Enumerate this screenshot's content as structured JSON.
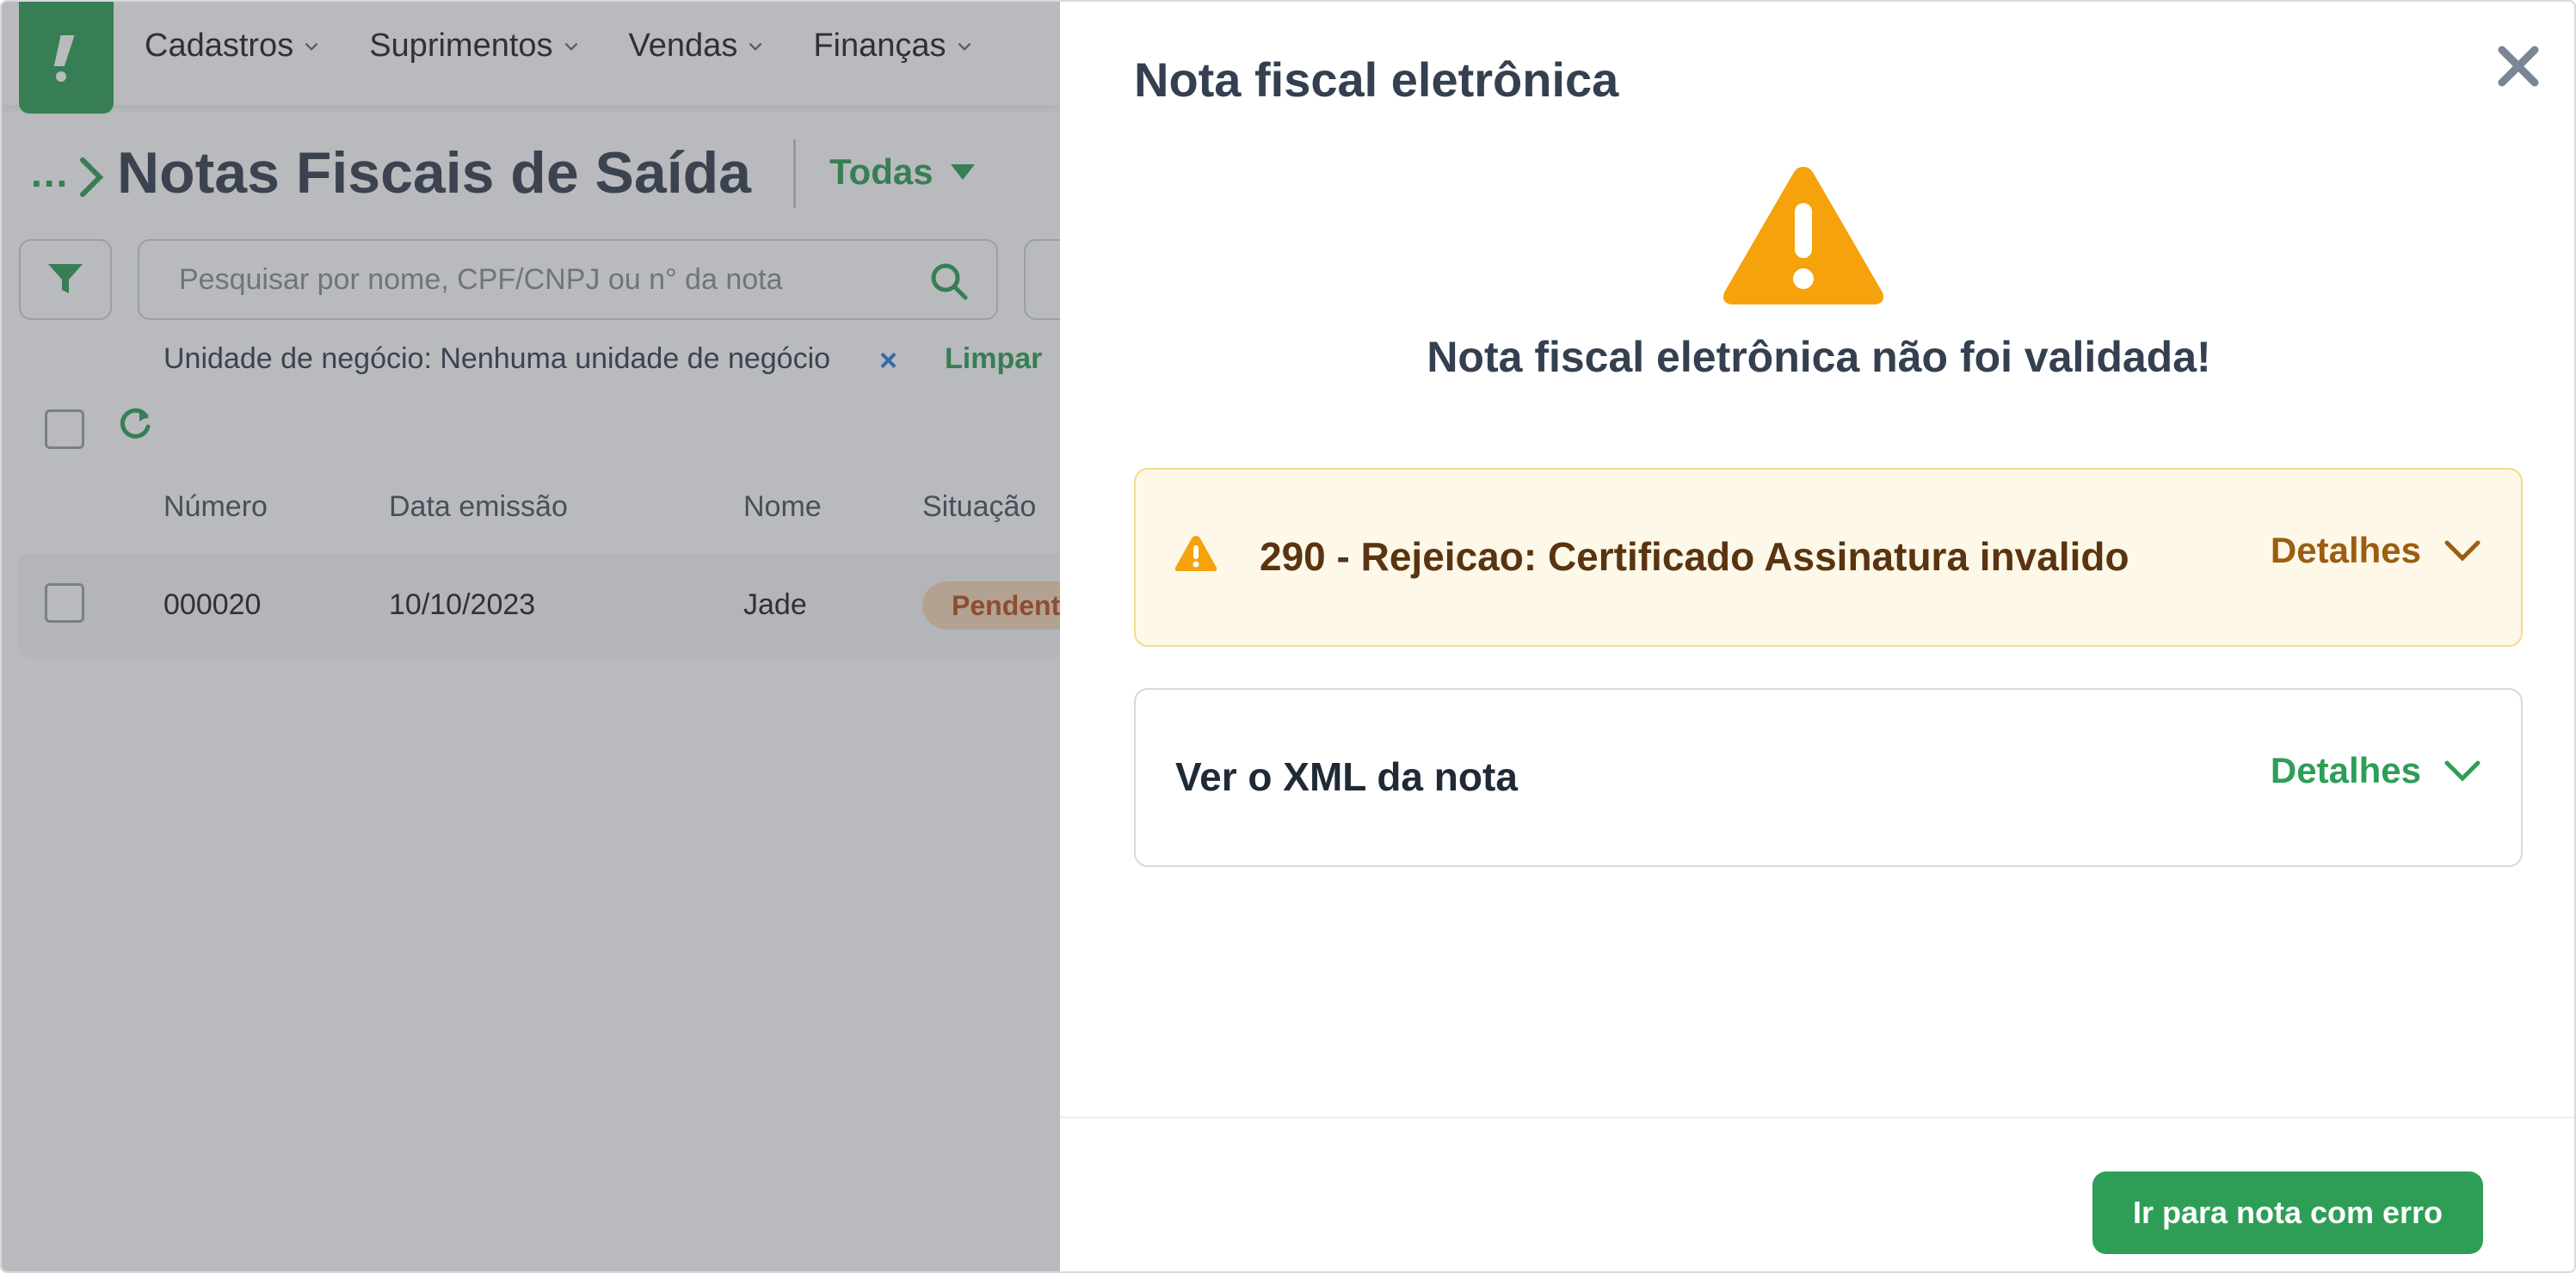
{
  "nav": {
    "items": [
      {
        "label": "Cadastros"
      },
      {
        "label": "Suprimentos"
      },
      {
        "label": "Vendas"
      },
      {
        "label": "Finanças"
      }
    ]
  },
  "page": {
    "breadcrumb_dots": "...",
    "title": "Notas Fiscais de Saída",
    "filter_select": "Todas"
  },
  "search": {
    "placeholder": "Pesquisar por nome, CPF/CNPJ ou n° da nota"
  },
  "filter_chip": {
    "label": "Unidade de negócio: Nenhuma unidade de negócio",
    "remove": "×",
    "clear": "Limpar"
  },
  "table": {
    "columns": [
      "Número",
      "Data emissão",
      "Nome",
      "Situação"
    ],
    "rows": [
      {
        "numero": "000020",
        "data": "10/10/2023",
        "nome": "Jade",
        "situacao": "Pendente"
      }
    ]
  },
  "drawer": {
    "title": "Nota fiscal eletrônica",
    "message": "Nota fiscal eletrônica não foi validada!",
    "error_item": {
      "text": "290 - Rejeicao: Certificado Assinatura invalido",
      "toggle": "Detalhes"
    },
    "xml_item": {
      "text": "Ver o XML da nota",
      "toggle": "Detalhes"
    },
    "primary_button": "Ir para nota com erro"
  },
  "colors": {
    "brand_green": "#2e9e57",
    "warning_orange": "#f5a20c",
    "error_bg": "#fdf8e8",
    "pending_badge_bg": "#f6d9b9",
    "pending_badge_text": "#b8501c"
  }
}
